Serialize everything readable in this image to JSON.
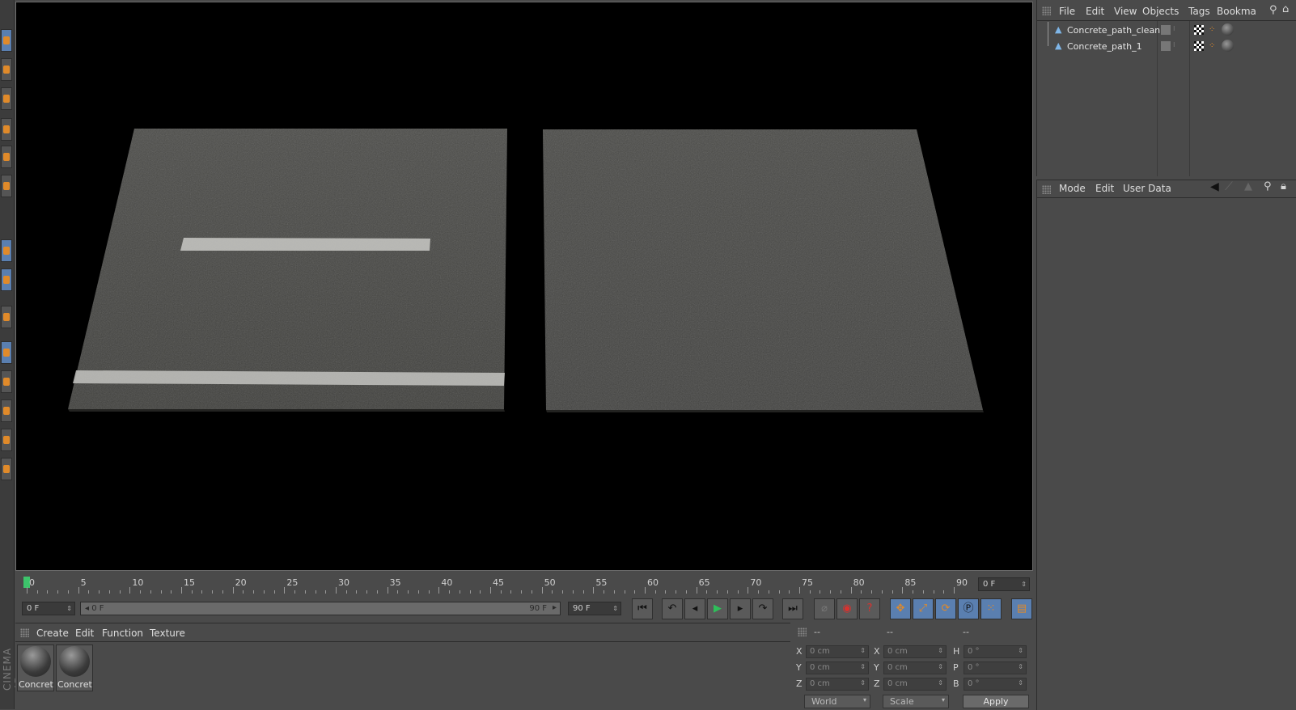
{
  "app": {
    "brand": "CINEMA 4D"
  },
  "object_manager": {
    "menu": [
      "File",
      "Edit",
      "View",
      "Objects",
      "Tags",
      "Bookma"
    ],
    "objects": [
      {
        "name": "Concrete_path_clean"
      },
      {
        "name": "Concrete_path_1"
      }
    ]
  },
  "attribute_manager": {
    "menu": [
      "Mode",
      "Edit",
      "User Data"
    ]
  },
  "timeline": {
    "ruler_labels": [
      "0",
      "5",
      "10",
      "15",
      "20",
      "25",
      "30",
      "35",
      "40",
      "45",
      "50",
      "55",
      "60",
      "65",
      "70",
      "75",
      "80",
      "85",
      "90"
    ],
    "current_frame": "0 F",
    "start_field": "0 F",
    "range_start": "0 F",
    "range_end": "90 F",
    "end_field": "90 F",
    "playhead_fraction": 0.0
  },
  "material_manager": {
    "menu": [
      "Create",
      "Edit",
      "Function",
      "Texture"
    ],
    "materials": [
      {
        "label": "Concret"
      },
      {
        "label": "Concret"
      }
    ]
  },
  "coordinates": {
    "headers": [
      "--",
      "--",
      "--"
    ],
    "rows": [
      {
        "a_label": "X",
        "a_value": "0 cm",
        "b_label": "X",
        "b_value": "0 cm",
        "c_label": "H",
        "c_value": "0 °"
      },
      {
        "a_label": "Y",
        "a_value": "0 cm",
        "b_label": "Y",
        "b_value": "0 cm",
        "c_label": "P",
        "c_value": "0 °"
      },
      {
        "a_label": "Z",
        "a_value": "0 cm",
        "b_label": "Z",
        "b_value": "0 cm",
        "c_label": "B",
        "c_value": "0 °"
      }
    ],
    "mode_dropdown": "World",
    "scale_dropdown": "Scale",
    "apply_label": "Apply"
  },
  "colors": {
    "playhead": "#3dc46b",
    "accent_blue": "#5a7fb0",
    "accent_orange": "#e08a2a"
  }
}
